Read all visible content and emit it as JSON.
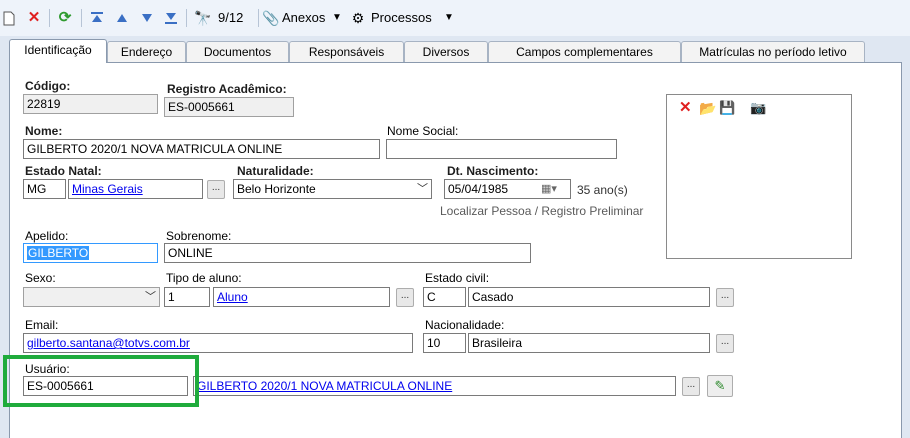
{
  "toolbar": {
    "page_indicator": "9/12",
    "attachments_label": "Anexos",
    "processes_label": "Processos"
  },
  "tabs": [
    {
      "label": "Identificação"
    },
    {
      "label": "Endereço"
    },
    {
      "label": "Documentos"
    },
    {
      "label": "Responsáveis"
    },
    {
      "label": "Diversos"
    },
    {
      "label": "Campos complementares"
    },
    {
      "label": "Matrículas no período letivo"
    }
  ],
  "form": {
    "codigo_label": "Código:",
    "codigo_value": "22819",
    "registro_label": "Registro Acadêmico:",
    "registro_value": "ES-0005661",
    "nome_label": "Nome:",
    "nome_value": "GILBERTO 2020/1 NOVA MATRICULA ONLINE",
    "nome_social_label": "Nome Social:",
    "nome_social_value": "",
    "estado_natal_label": "Estado Natal:",
    "estado_natal_code": "MG",
    "estado_natal_name": "Minas Gerais",
    "naturalidade_label": "Naturalidade:",
    "naturalidade_value": "Belo Horizonte",
    "dt_nascimento_label": "Dt. Nascimento:",
    "dt_nascimento_value": "05/04/1985",
    "idade_value": "35 ano(s)",
    "localizar_link": "Localizar Pessoa / Registro Preliminar",
    "apelido_label": "Apelido:",
    "apelido_value": "GILBERTO",
    "sobrenome_label": "Sobrenome:",
    "sobrenome_value": "ONLINE",
    "sexo_label": "Sexo:",
    "sexo_value": "",
    "tipo_aluno_label": "Tipo de aluno:",
    "tipo_aluno_code": "1",
    "tipo_aluno_name": "Aluno",
    "estado_civil_label": "Estado civil:",
    "estado_civil_code": "C",
    "estado_civil_name": "Casado",
    "email_label": "Email:",
    "email_value": "gilberto.santana@totvs.com.br",
    "nacionalidade_label": "Nacionalidade:",
    "nacionalidade_code": "10",
    "nacionalidade_name": "Brasileira",
    "usuario_label": "Usuário:",
    "usuario_value": "ES-0005661",
    "usuario_name": "GILBERTO 2020/1 NOVA MATRICULA ONLINE",
    "dots_label": "..."
  },
  "colors": {
    "highlight_box": "#1fab3c",
    "link": "#0000ee",
    "selection": "#3399ff"
  }
}
